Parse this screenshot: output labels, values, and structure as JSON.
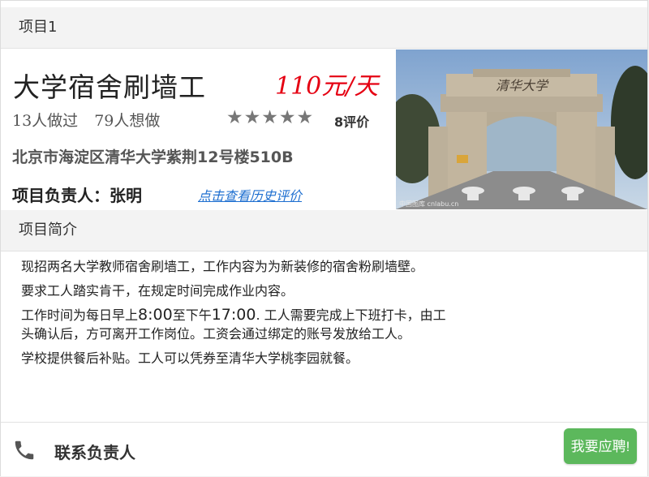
{
  "header": {
    "title": "项目1"
  },
  "project": {
    "title": "大学宿舍刷墙工",
    "price": "110元/天",
    "done_count": "13人做过",
    "want_count": "79人想做",
    "rating_stars": "★★★★★",
    "rating": 5,
    "reviews": "8评价",
    "address": "北京市海淀区清华大学紫荆12号楼510B",
    "manager": "项目负责人：张明",
    "history_link": "点击查看历史评价",
    "photo_caption": "中国图库 cnlabu.cn"
  },
  "intro": {
    "title": "项目简介",
    "line1": "现招两名大学教师宿舍刷墙工，工作内容为为新装修的宿舍粉刷墙壁。",
    "line2": "要求工人踏实肯干，在规定时间完成作业内容。",
    "line3_a": "工作时间为每日早上",
    "line3_time1": "8:00",
    "line3_b": "至下午",
    "line3_time2": "17:00",
    "line3_c": ". 工人需要完成上下班打卡，由工",
    "line4": "头确认后，方可离开工作岗位。工资会通过绑定的账号发放给工人。",
    "line5": "学校提供餐后补贴。工人可以凭券至清华大学桃李园就餐。"
  },
  "footer": {
    "contact_label": "联系负责人",
    "apply_label": "我要应聘!"
  },
  "icons": {
    "phone": "phone-icon",
    "star": "star-icon"
  },
  "colors": {
    "price": "#e50012",
    "link": "#1e6fd0",
    "apply_button": "#5cb85c"
  }
}
